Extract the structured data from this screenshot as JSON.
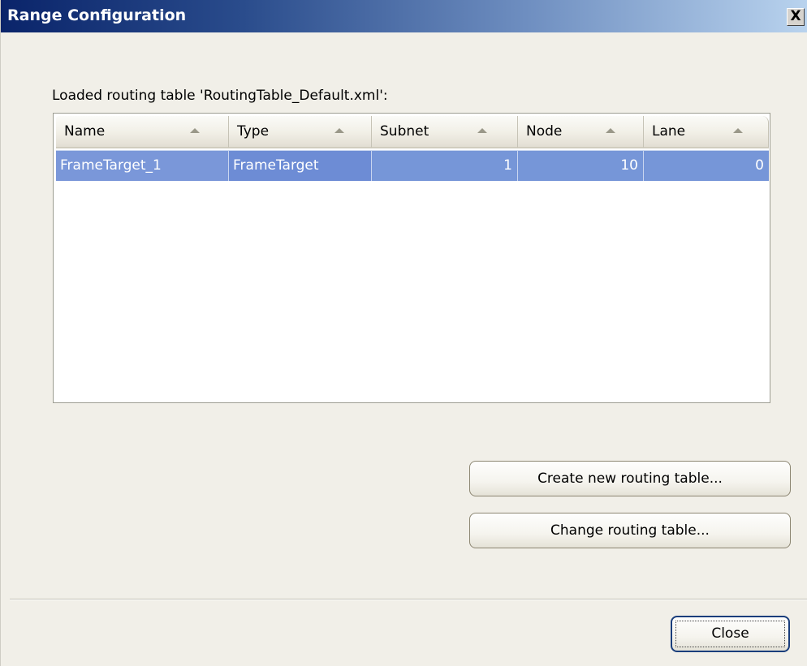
{
  "window": {
    "title": "Range Configuration",
    "close_glyph": "X"
  },
  "caption": "Loaded routing table 'RoutingTable_Default.xml':",
  "table": {
    "columns": [
      "Name",
      "Type",
      "Subnet",
      "Node",
      "Lane"
    ],
    "sort_direction": "ascending",
    "rows": [
      {
        "name": "FrameTarget_1",
        "type": "FrameTarget",
        "subnet": "1",
        "node": "10",
        "lane": "0",
        "selected": true
      }
    ]
  },
  "buttons": {
    "create": "Create new routing table...",
    "change": "Change routing table...",
    "close": "Close"
  },
  "colors": {
    "title_gradient_start": "#0a246a",
    "title_gradient_end": "#b9d3ee",
    "selection": "#7696d8",
    "dialog_bg": "#f1efe8"
  },
  "icons": {
    "window_close": "close-icon",
    "sort": "sort-ascending-icon"
  }
}
